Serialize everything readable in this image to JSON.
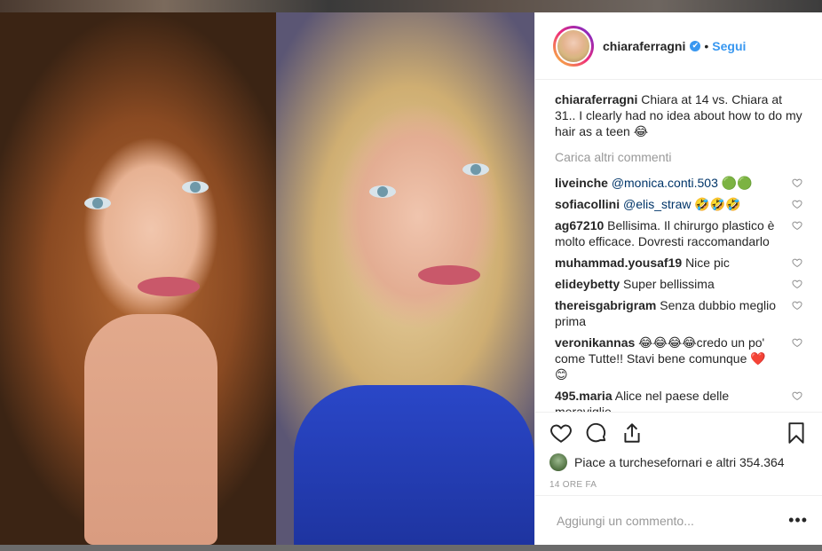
{
  "post": {
    "username": "chiaraferragni",
    "verified_mark": "✔",
    "dot": "•",
    "follow_label": "Segui",
    "caption": "Chiara at 14 vs. Chiara at 31.. I clearly had no idea about how to do my hair as a teen 😂",
    "load_more": "Carica altri commenti"
  },
  "comments": [
    {
      "user": "liveinche",
      "mention": "@monica.conti.503",
      "text": " 🟢🟢"
    },
    {
      "user": "sofiacollini",
      "mention": "@elis_straw",
      "text": " 🤣🤣🤣"
    },
    {
      "user": "ag67210",
      "mention": "",
      "text": "Bellisima. Il chirurgo plastico è molto efficace. Dovresti raccomandarlo"
    },
    {
      "user": "muhammad.yousaf19",
      "mention": "",
      "text": "Nice pic"
    },
    {
      "user": "elideybetty",
      "mention": "",
      "text": "Super bellissima"
    },
    {
      "user": "thereisgabrigram",
      "mention": "",
      "text": "Senza dubbio meglio prima"
    },
    {
      "user": "veronikannas",
      "mention": "",
      "text": "😂😂😂😂credo un po' come Tutte!! Stavi bene comunque ❤️😊"
    },
    {
      "user": "495.maria",
      "mention": "",
      "text": "Alice nel paese delle meraviglie"
    }
  ],
  "actions": {
    "likes_text": "Piace a turchesefornari e altri 354.364",
    "timestamp": "14 ORE FA",
    "comment_placeholder": "Aggiungi un commento...",
    "more_label": "•••"
  },
  "icons": {
    "like": "heart-icon",
    "comment": "comment-icon",
    "share": "share-icon",
    "save": "bookmark-icon"
  }
}
